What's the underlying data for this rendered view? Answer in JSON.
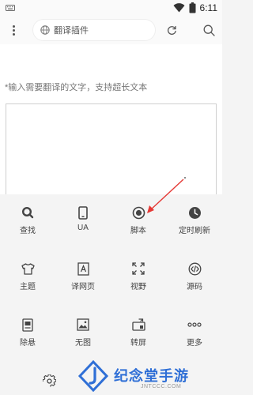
{
  "status_bar": {
    "time": "6:11",
    "icons": [
      "keyboard-icon",
      "wifi-icon",
      "battery-icon"
    ]
  },
  "toolbar": {
    "url_text": "翻译插件",
    "icons": [
      "more-vertical-icon",
      "globe-icon",
      "reload-icon",
      "search-icon"
    ]
  },
  "content": {
    "hint_text": "*输入需要翻译的文字，支持超长文本"
  },
  "menu": {
    "items": [
      {
        "label": "查找",
        "icon": "search-icon"
      },
      {
        "label": "UA",
        "icon": "phone-icon"
      },
      {
        "label": "脚本",
        "icon": "record-icon"
      },
      {
        "label": "定时刷新",
        "icon": "clock-icon"
      },
      {
        "label": "主题",
        "icon": "shirt-icon"
      },
      {
        "label": "译网页",
        "icon": "translate-page-icon"
      },
      {
        "label": "视野",
        "icon": "expand-icon"
      },
      {
        "label": "源码",
        "icon": "code-icon"
      },
      {
        "label": "除悬",
        "icon": "no-float-icon"
      },
      {
        "label": "无图",
        "icon": "image-icon"
      },
      {
        "label": "转屏",
        "icon": "rotate-screen-icon"
      },
      {
        "label": "更多",
        "icon": "more-horizontal-icon"
      }
    ]
  },
  "bottom": {
    "icon": "settings-icon"
  },
  "watermark": {
    "title": "纪念堂手游",
    "subtitle": "JNTCCC.COM"
  },
  "colors": {
    "accent": "#2f6fd6",
    "annotation_arrow": "#e53935",
    "icon": "#555555"
  }
}
